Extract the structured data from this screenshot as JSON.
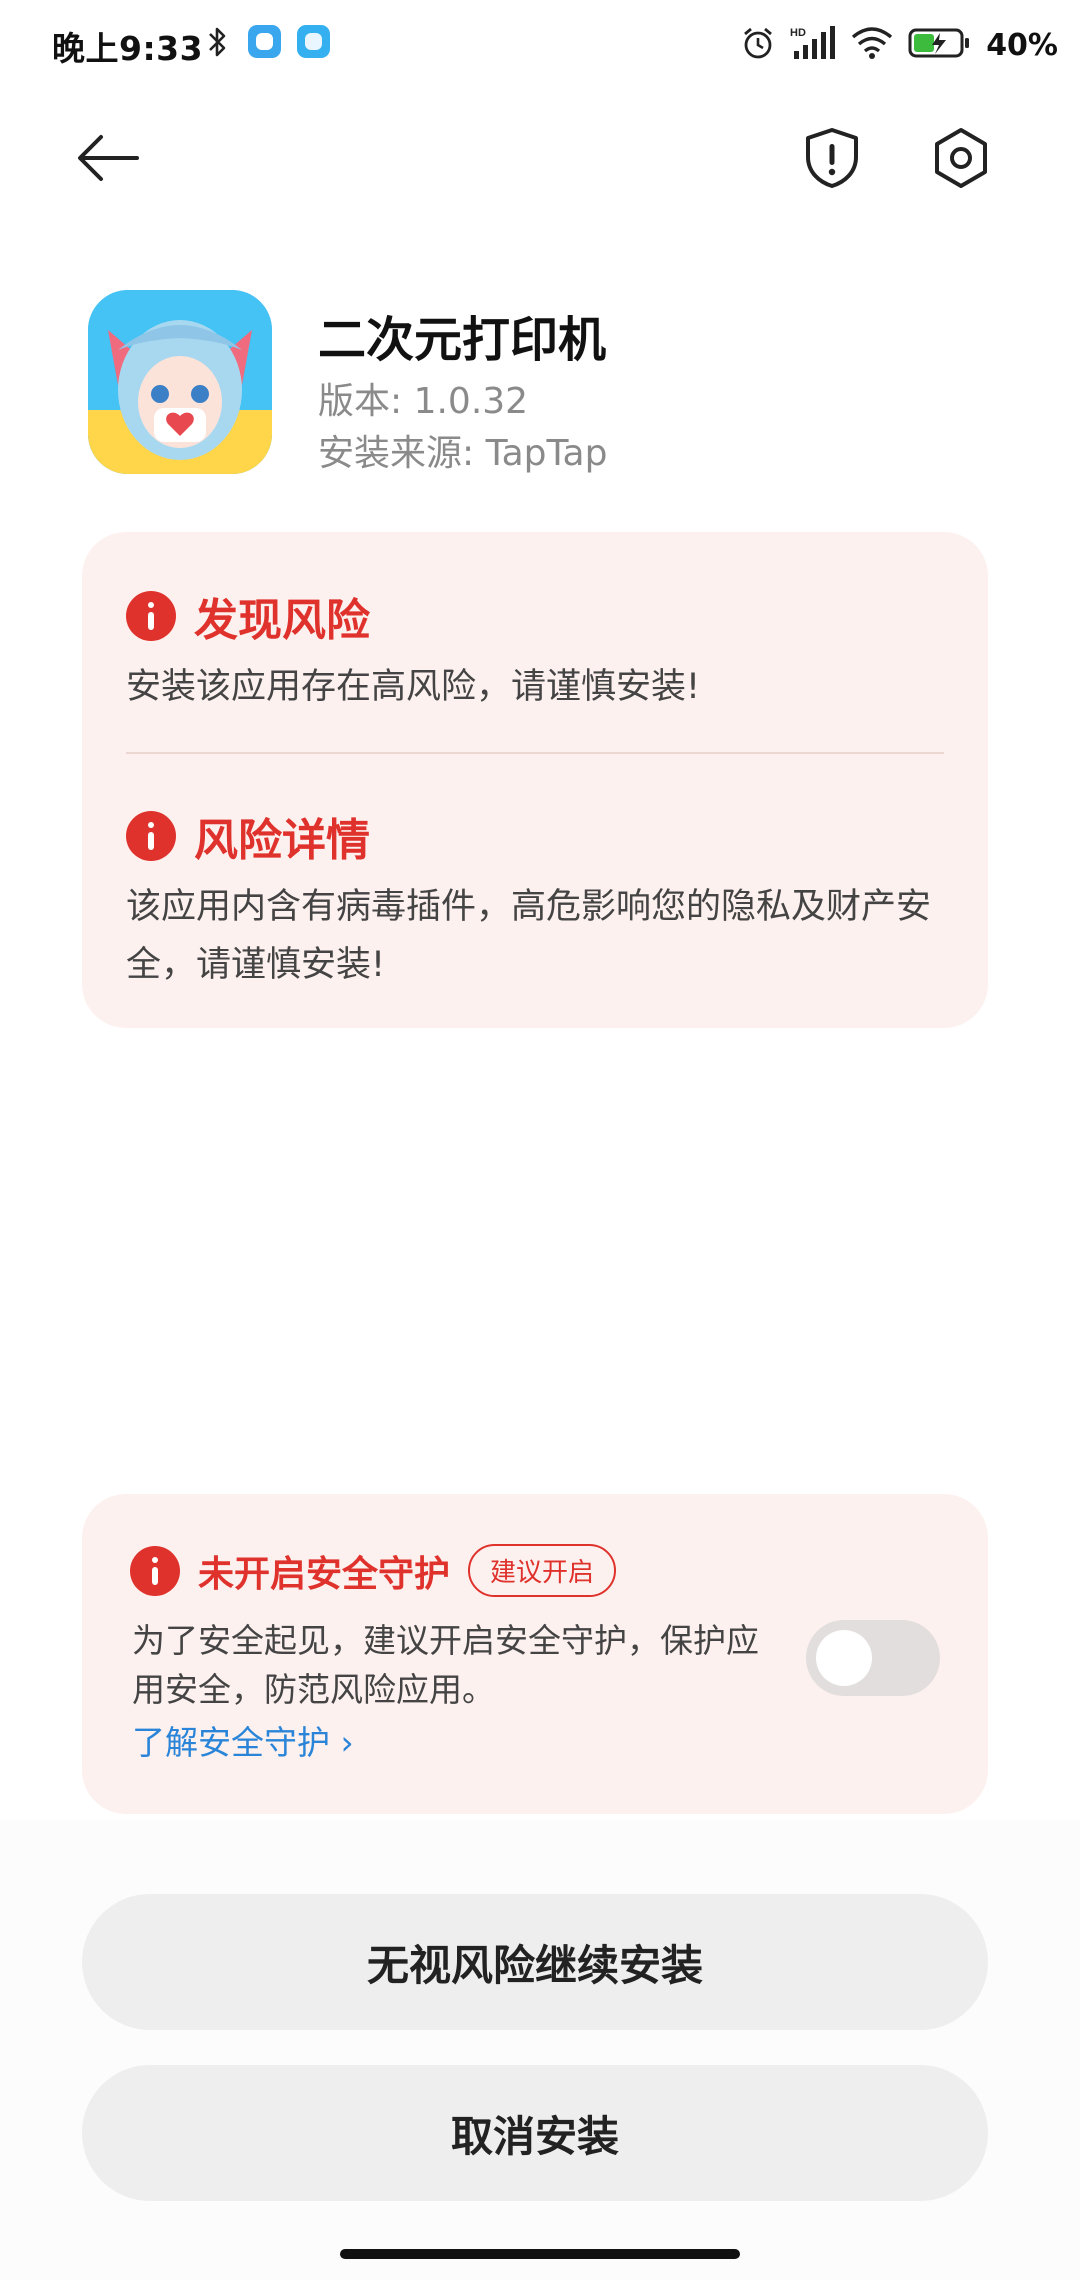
{
  "status_bar": {
    "time": "晚上9:33",
    "battery_text": "40%",
    "icons": [
      "bluetooth-icon",
      "app-notification-icon",
      "app-notification-icon",
      "alarm-icon",
      "hd-signal-icon",
      "wifi-icon",
      "battery-charging-icon"
    ]
  },
  "nav": {
    "back_icon": "back-arrow-icon",
    "shield_icon": "shield-alert-icon",
    "settings_icon": "gear-icon"
  },
  "app": {
    "name": "二次元打印机",
    "version": "版本: 1.0.32",
    "source": "安装来源: TapTap"
  },
  "risk": {
    "found_title": "发现风险",
    "found_text": "安装该应用存在高风险，请谨慎安装!",
    "detail_title": "风险详情",
    "detail_text": "该应用内含有病毒插件，高危影响您的隐私及财产安全，请谨慎安装!"
  },
  "protection": {
    "title": "未开启安全守护",
    "badge": "建议开启",
    "description": "为了安全起见，建议开启安全守护，保护应用安全，防范风险应用。",
    "learn_more": "了解安全守护 ›",
    "enabled": false
  },
  "buttons": {
    "continue": "无视风险继续安装",
    "cancel": "取消安装"
  },
  "colors": {
    "danger": "#e0322c",
    "card_bg": "#fdf1ef",
    "link": "#2a85d8",
    "button_bg": "#eeeeee"
  }
}
